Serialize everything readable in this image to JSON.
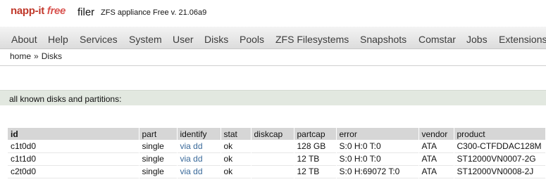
{
  "header": {
    "brand": "napp-it",
    "brand_free": "free",
    "product": "filer",
    "subtitle": "ZFS appliance Free v. 21.06a9"
  },
  "nav": {
    "items": [
      "About",
      "Help",
      "Services",
      "System",
      "User",
      "Disks",
      "Pools",
      "ZFS Filesystems",
      "Snapshots",
      "Comstar",
      "Jobs",
      "Extensions"
    ]
  },
  "breadcrumb": {
    "home": "home",
    "separator": "»",
    "current": "Disks"
  },
  "section": {
    "title": "all known disks and partitions:"
  },
  "table": {
    "columns": [
      "id",
      "part",
      "identify",
      "stat",
      "diskcap",
      "partcap",
      "error",
      "vendor",
      "product"
    ],
    "rows": [
      {
        "id": "c1t0d0",
        "part": "single",
        "identify": "via dd",
        "stat": "ok",
        "diskcap": "",
        "partcap": "128 GB",
        "error": "S:0 H:0 T:0",
        "vendor": "ATA",
        "product": "C300-CTFDDAC128M"
      },
      {
        "id": "c1t1d0",
        "part": "single",
        "identify": "via dd",
        "stat": "ok",
        "diskcap": "",
        "partcap": "12 TB",
        "error": "S:0 H:0 T:0",
        "vendor": "ATA",
        "product": "ST12000VN0007-2G"
      },
      {
        "id": "c2t0d0",
        "part": "single",
        "identify": "via dd",
        "stat": "ok",
        "diskcap": "",
        "partcap": "12 TB",
        "error": "S:0 H:69072 T:0",
        "vendor": "ATA",
        "product": "ST12000VN0008-2J"
      }
    ]
  },
  "colors": {
    "brand_red": "#c0392b",
    "link": "#3a6a9a",
    "section_bg": "#e2e8e0",
    "header_row_bg": "#d6d6d6"
  }
}
